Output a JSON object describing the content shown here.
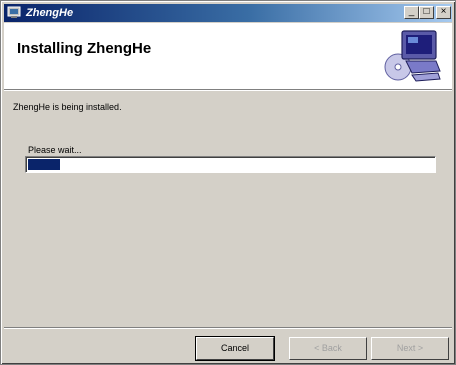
{
  "window": {
    "title": "ZhengHe",
    "icon": "installer-icon",
    "controls": {
      "minimize": "_",
      "maximize": "□",
      "close": "×"
    }
  },
  "header": {
    "title": "Installing ZhengHe",
    "graphic": "computer-installer-icon"
  },
  "body": {
    "status_text": "ZhengHe is being installed.",
    "progress_label": "Please wait...",
    "progress_fraction": 0.08
  },
  "buttons": {
    "cancel": "Cancel",
    "back": "< Back",
    "next": "Next >",
    "back_enabled": false,
    "next_enabled": false
  },
  "colors": {
    "titlebar_start": "#0a246a",
    "titlebar_end": "#a6caf0",
    "progress_fill": "#0a246a",
    "window_bg": "#d4d0c8"
  }
}
